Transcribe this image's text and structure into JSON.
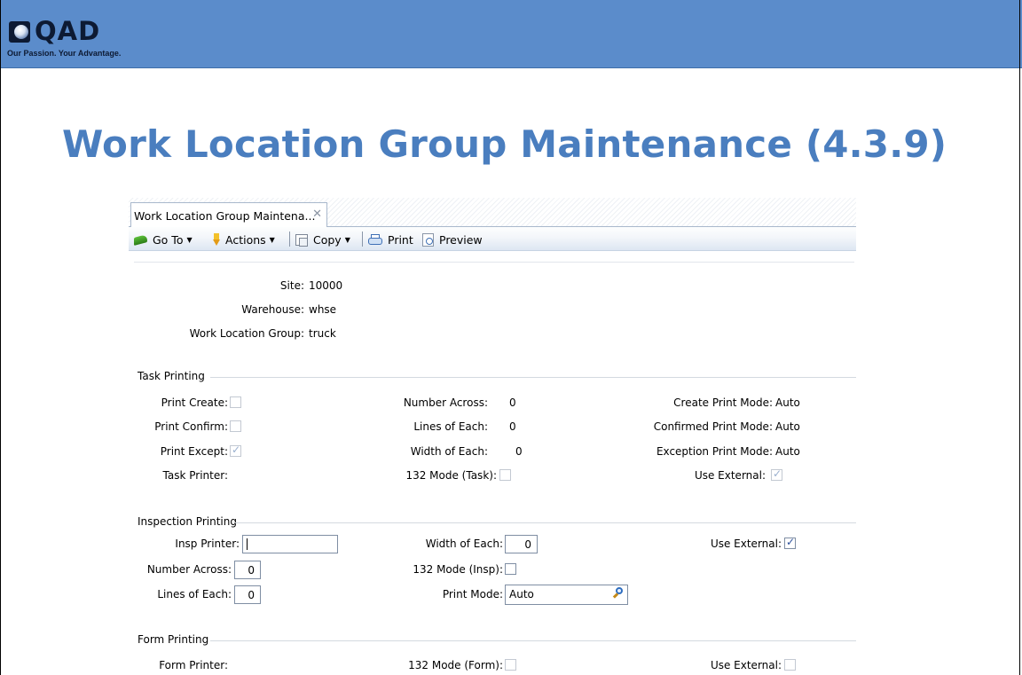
{
  "slide": {
    "logo_word": "QAD",
    "logo_tagline": "Our Passion. Your Advantage.",
    "title": "Work Location Group Maintenance (4.3.9)",
    "banner_color": "#5b8ccb",
    "title_color": "#4a7ebf"
  },
  "app": {
    "tab_label": "Work Location Group Maintena...",
    "tab_close": "✕",
    "toolbar": {
      "goto_label": "Go To",
      "actions_label": "Actions",
      "copy_label": "Copy",
      "print_label": "Print",
      "preview_label": "Preview"
    },
    "header": {
      "site_label": "Site:",
      "site_value": "10000",
      "warehouse_label": "Warehouse:",
      "warehouse_value": "whse",
      "wlg_label": "Work Location Group:",
      "wlg_value": "truck"
    },
    "task_printing": {
      "title": "Task Printing",
      "print_create_label": "Print Create:",
      "print_confirm_label": "Print Confirm:",
      "print_except_label": "Print Except:",
      "task_printer_label": "Task Printer:",
      "number_across_label": "Number Across:",
      "number_across_value": "0",
      "lines_of_each_label": "Lines of Each:",
      "lines_of_each_value": "0",
      "width_of_each_label": "Width of Each:",
      "width_of_each_value": "0",
      "mode132_label": "132 Mode (Task):",
      "create_print_mode_label": "Create Print Mode:",
      "create_print_mode_value": "Auto",
      "confirmed_print_mode_label": "Confirmed Print Mode:",
      "confirmed_print_mode_value": "Auto",
      "exception_print_mode_label": "Exception Print Mode:",
      "exception_print_mode_value": "Auto",
      "use_external_label": "Use External:",
      "print_create_checked": false,
      "print_confirm_checked": false,
      "print_except_checked": true,
      "mode132_checked": false,
      "use_external_checked": true
    },
    "inspection_printing": {
      "title": "Inspection Printing",
      "insp_printer_label": "Insp Printer:",
      "insp_printer_value": "",
      "number_across_label": "Number Across:",
      "number_across_value": "0",
      "lines_of_each_label": "Lines of Each:",
      "lines_of_each_value": "0",
      "width_of_each_label": "Width of Each:",
      "width_of_each_value": "0",
      "mode132_label": "132 Mode (Insp):",
      "print_mode_label": "Print Mode:",
      "print_mode_value": "Auto",
      "use_external_label": "Use External:",
      "mode132_checked": false,
      "use_external_checked": true
    },
    "form_printing": {
      "title": "Form Printing",
      "form_printer_label": "Form Printer:",
      "mode132_label": "132 Mode (Form):",
      "use_external_label": "Use External:",
      "mode132_checked": false,
      "use_external_checked": false
    }
  }
}
